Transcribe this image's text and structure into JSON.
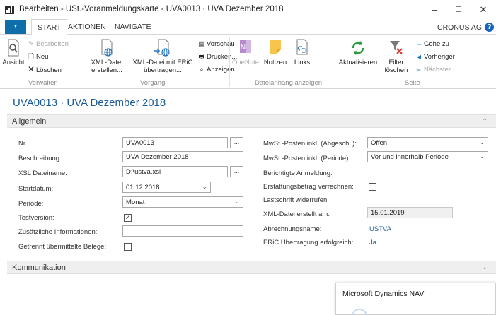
{
  "window": {
    "title": "Bearbeiten - USt.-Voranmeldungskarte - UVA0013 · UVA Dezember 2018",
    "minimize": "–",
    "maximize": "☐",
    "close": "✕"
  },
  "ribbon_tabs": {
    "menu": "▼",
    "tabs": [
      "START",
      "AKTIONEN",
      "NAVIGATE"
    ],
    "company": "CRONUS AG",
    "help": "?"
  },
  "ribbon": {
    "groups": {
      "verwalten": {
        "label": "Verwalten",
        "ansicht": "Ansicht",
        "bearbeiten": "Bearbeiten",
        "neu": "Neu",
        "loeschen": "Löschen"
      },
      "vorgang": {
        "label": "Vorgang",
        "xml_erstellen_1": "XML-Datei",
        "xml_erstellen_2": "erstellen...",
        "xml_eric_1": "XML-Datei mit ERiC",
        "xml_eric_2": "übertragen...",
        "vorschau": "Vorschau",
        "drucken": "Drucken...",
        "anzeigen": "Anzeigen"
      },
      "dateianhang": {
        "label": "Dateianhang anzeigen",
        "onenote": "OneNote",
        "notizen": "Notizen",
        "links": "Links"
      },
      "seite": {
        "label": "Seite",
        "aktualisieren": "Aktualisieren",
        "filter_1": "Filter",
        "filter_2": "löschen",
        "gehe_zu": "Gehe zu",
        "vorheriger": "Vorheriger",
        "naechster": "Nächster"
      }
    }
  },
  "page": {
    "title": "UVA0013 · UVA Dezember 2018"
  },
  "allgemein": {
    "header": "Allgemein",
    "collapse_icon": "⌃",
    "left": {
      "nr_label": "Nr.:",
      "nr_value": "UVA0013",
      "beschreibung_label": "Beschreibung:",
      "beschreibung_value": "UVA Dezember 2018",
      "xsl_label": "XSL Dateiname:",
      "xsl_value": "D:\\ustva.xsl",
      "startdatum_label": "Startdatum:",
      "startdatum_value": "01.12.2018",
      "periode_label": "Periode:",
      "periode_value": "Monat",
      "testversion_label": "Testversion:",
      "testversion_checked": true,
      "zusaetzliche_label": "Zusätzliche Informationen:",
      "zusaetzliche_value": "",
      "getrennt_label": "Getrennt übermittelte Belege:",
      "getrennt_checked": false,
      "assist_glyph": "..."
    },
    "right": {
      "mwst_abgeschl_label": "MwSt.-Posten inkl. (Abgeschl.):",
      "mwst_abgeschl_value": "Offen",
      "mwst_periode_label": "MwSt.-Posten inkl. (Periode):",
      "mwst_periode_value": "Vor und innerhalb Periode",
      "berichtigte_label": "Berichtigte Anmeldung:",
      "erstattung_label": "Erstattungsbetrag verrechnen:",
      "lastschrift_label": "Lastschrift widerrufen:",
      "xml_erstellt_label": "XML-Datei erstellt am:",
      "xml_erstellt_value": "15.01.2019",
      "abrechnung_label": "Abrechnungsname:",
      "abrechnung_value": "USTVA",
      "eric_label": "ERiC Übertragung erfolgreich:",
      "eric_value": "Ja"
    }
  },
  "kommunikation": {
    "header": "Kommunikation",
    "expand_icon": "⌄"
  },
  "notification": {
    "title": "Microsoft Dynamics NAV"
  }
}
